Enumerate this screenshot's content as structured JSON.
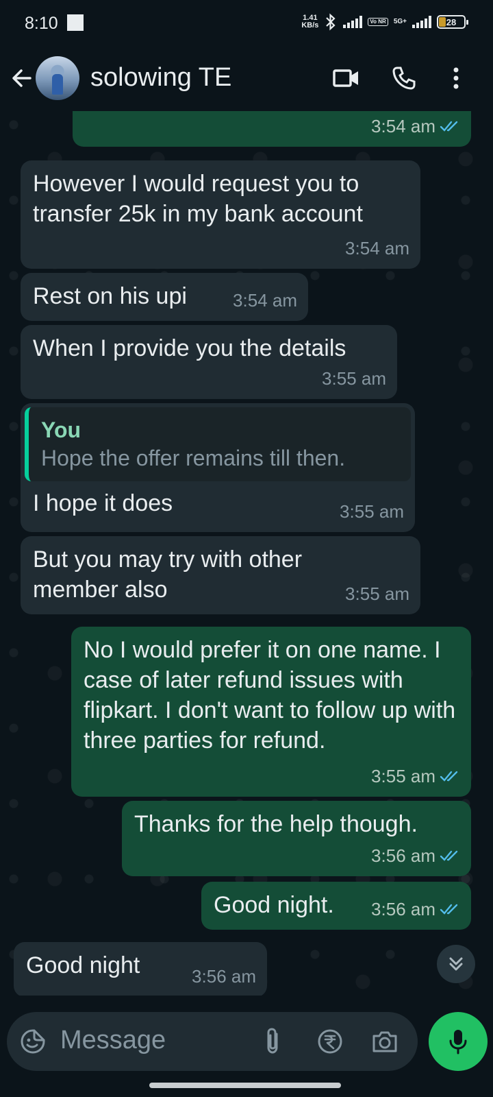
{
  "status_bar": {
    "time": "8:10",
    "net_speed_value": "1.41",
    "net_speed_unit": "KB/s",
    "volte": "Vo NR",
    "network": "5G+",
    "battery": "28"
  },
  "header": {
    "contact_name": "solowing TE"
  },
  "messages": [
    {
      "text": "",
      "time": "3:54 am"
    },
    {
      "text": "However I would request you to transfer 25k in my bank account",
      "time": "3:54 am"
    },
    {
      "text": "Rest on his upi",
      "time": "3:54 am"
    },
    {
      "text": "When I provide you the details",
      "time": "3:55 am"
    },
    {
      "quote_author": "You",
      "quote_text": "Hope the offer remains till then.",
      "text": "I hope it does",
      "time": "3:55 am"
    },
    {
      "text": "But you may try with other member also",
      "time": "3:55 am"
    },
    {
      "text": "No I would prefer it on one name. I case of later refund issues with flipkart. I don't want to follow up with three parties for refund.",
      "time": "3:55 am"
    },
    {
      "text": "Thanks for the help though.",
      "time": "3:56 am"
    },
    {
      "text": "Good night.",
      "time": "3:56 am"
    },
    {
      "text": "Good night",
      "time": "3:56 am"
    }
  ],
  "input": {
    "placeholder": "Message"
  },
  "colors": {
    "background": "#0b141a",
    "incoming_bubble": "#202c33",
    "outgoing_bubble": "#144d37",
    "read_ticks": "#53bdeb",
    "accent_green": "#21c063"
  },
  "icons": [
    "back-arrow-icon",
    "video-call-icon",
    "phone-icon",
    "more-options-icon",
    "sticker-icon",
    "attach-icon",
    "rupee-payment-icon",
    "camera-icon",
    "mic-icon",
    "scroll-down-icon",
    "double-check-icon"
  ]
}
